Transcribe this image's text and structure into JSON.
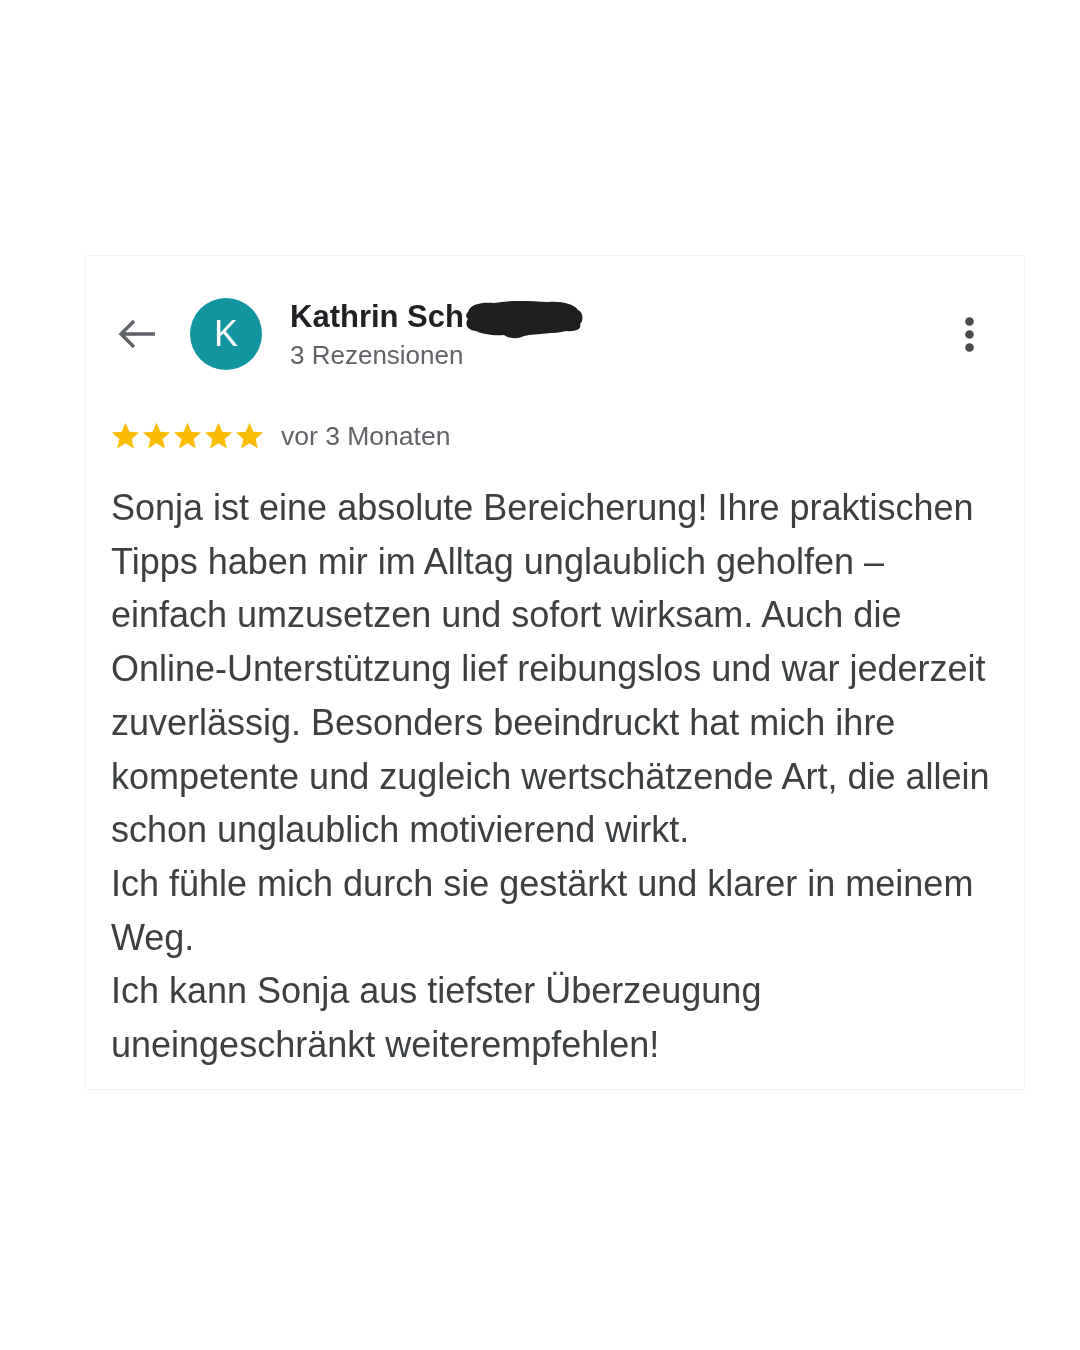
{
  "reviewer": {
    "initial": "K",
    "name": "Kathrin Sch",
    "name_redacted": true,
    "review_count": "3 Rezensionen"
  },
  "review": {
    "stars": 5,
    "time": "vor 3 Monaten",
    "paragraphs": [
      "Sonja ist eine absolute Bereicherung! Ihre praktischen Tipps haben mir im Alltag unglaublich geholfen – einfach umzusetzen und sofort wirksam. Auch die Online-Unterstützung lief reibungslos und war jederzeit zuverlässig. Besonders beeindruckt hat mich ihre kompetente und zugleich wertschätzende Art, die allein schon unglaublich motivierend wirkt.",
      "Ich fühle mich durch sie gestärkt und klarer in meinem Weg.",
      "Ich kann Sonja aus tiefster Überzeugung uneingeschränkt weiterempfehlen!"
    ]
  }
}
